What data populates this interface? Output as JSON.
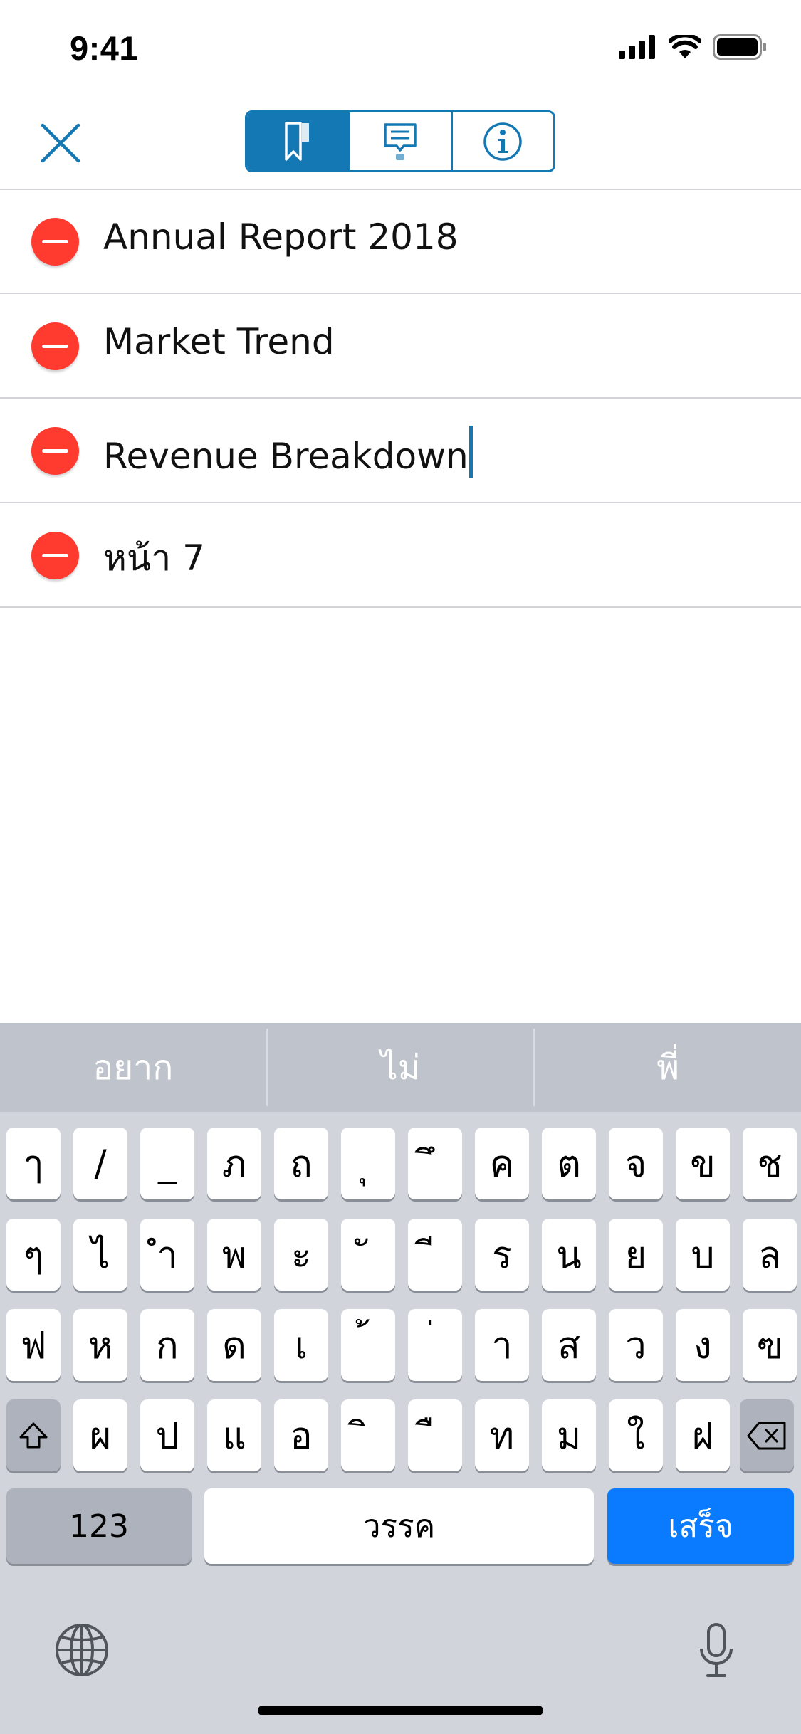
{
  "status_bar": {
    "time": "9:41"
  },
  "nav": {
    "close_icon": "close-x-icon",
    "segments": [
      {
        "icon": "bookmark-icon",
        "active": true
      },
      {
        "icon": "comment-icon",
        "active": false
      },
      {
        "icon": "info-icon",
        "active": false
      }
    ]
  },
  "bookmarks": [
    {
      "label": "Annual Report 2018"
    },
    {
      "label": "Market Trend"
    },
    {
      "label": "Revenue Breakdown",
      "editing": true
    },
    {
      "label": "หน้า 7"
    }
  ],
  "keyboard": {
    "suggestions": [
      "อยาก",
      "ไม่",
      "พี่"
    ],
    "row1": [
      "ๅ",
      "/",
      "_",
      "ภ",
      "ถ",
      "ุ",
      "ึ",
      "ค",
      "ต",
      "จ",
      "ข",
      "ช"
    ],
    "row2": [
      "ๆ",
      "ไ",
      "ำ",
      "พ",
      "ะ",
      "ั",
      "ี",
      "ร",
      "น",
      "ย",
      "บ",
      "ล"
    ],
    "row3": [
      "ฟ",
      "ห",
      "ก",
      "ด",
      "เ",
      "้",
      "่",
      "า",
      "ส",
      "ว",
      "ง",
      "ฃ"
    ],
    "row4": [
      "ผ",
      "ป",
      "แ",
      "อ",
      "ิ",
      "ื",
      "ท",
      "ม",
      "ใ",
      "ฝ"
    ],
    "numbers_label": "123",
    "space_label": "วรรค",
    "done_label": "เสร็จ",
    "accent_color": "#0a7bff"
  },
  "colors": {
    "brand": "#1478b4",
    "delete": "#ff3b30"
  }
}
